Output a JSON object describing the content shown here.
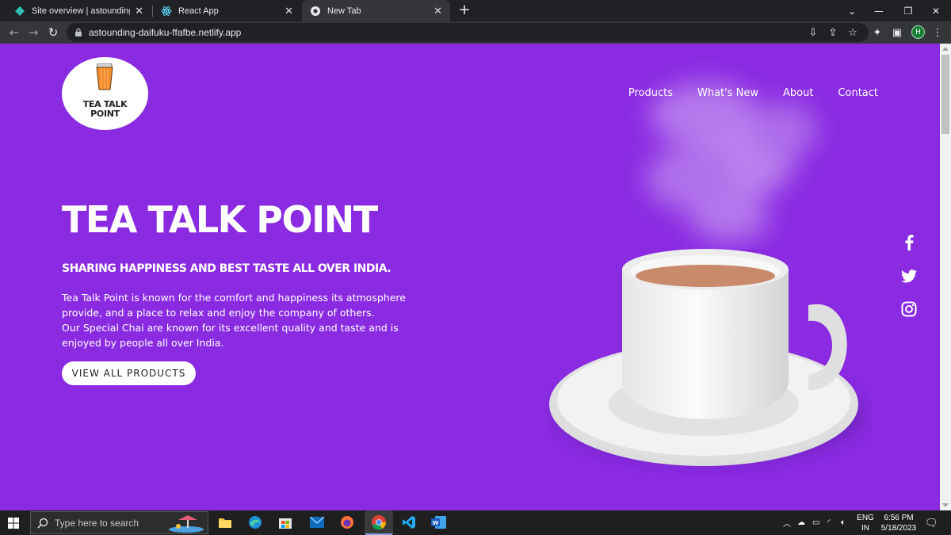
{
  "browser": {
    "tabs": [
      {
        "title": "Site overview | astounding-daifuk",
        "active": false
      },
      {
        "title": "React App",
        "active": false
      },
      {
        "title": "New Tab",
        "active": true
      }
    ],
    "url": "astounding-daifuku-ffafbe.netlify.app",
    "profile_initial": "H"
  },
  "site": {
    "logo_text_line1": "TEA TALK",
    "logo_text_line2": "POINT",
    "nav": [
      "Products",
      "What's New",
      "About",
      "Contact"
    ],
    "hero": {
      "title": "TEA TALK POINT",
      "subtitle": "SHARING HAPPINESS AND BEST TASTE ALL OVER INDIA.",
      "paragraph1": "Tea Talk Point is known for the comfort and happiness its atmosphere provide, and a place to relax and enjoy the company of others.",
      "paragraph2": "Our Special Chai are known for its excellent quality and taste and is enjoyed by people all over India.",
      "cta_label": "VIEW ALL PRODUCTS"
    },
    "social": [
      "facebook-icon",
      "twitter-icon",
      "instagram-icon"
    ],
    "background_color": "#8a2be2"
  },
  "taskbar": {
    "search_placeholder": "Type here to search",
    "lang_line1": "ENG",
    "lang_line2": "IN",
    "time": "6:56 PM",
    "date": "5/18/2023"
  }
}
